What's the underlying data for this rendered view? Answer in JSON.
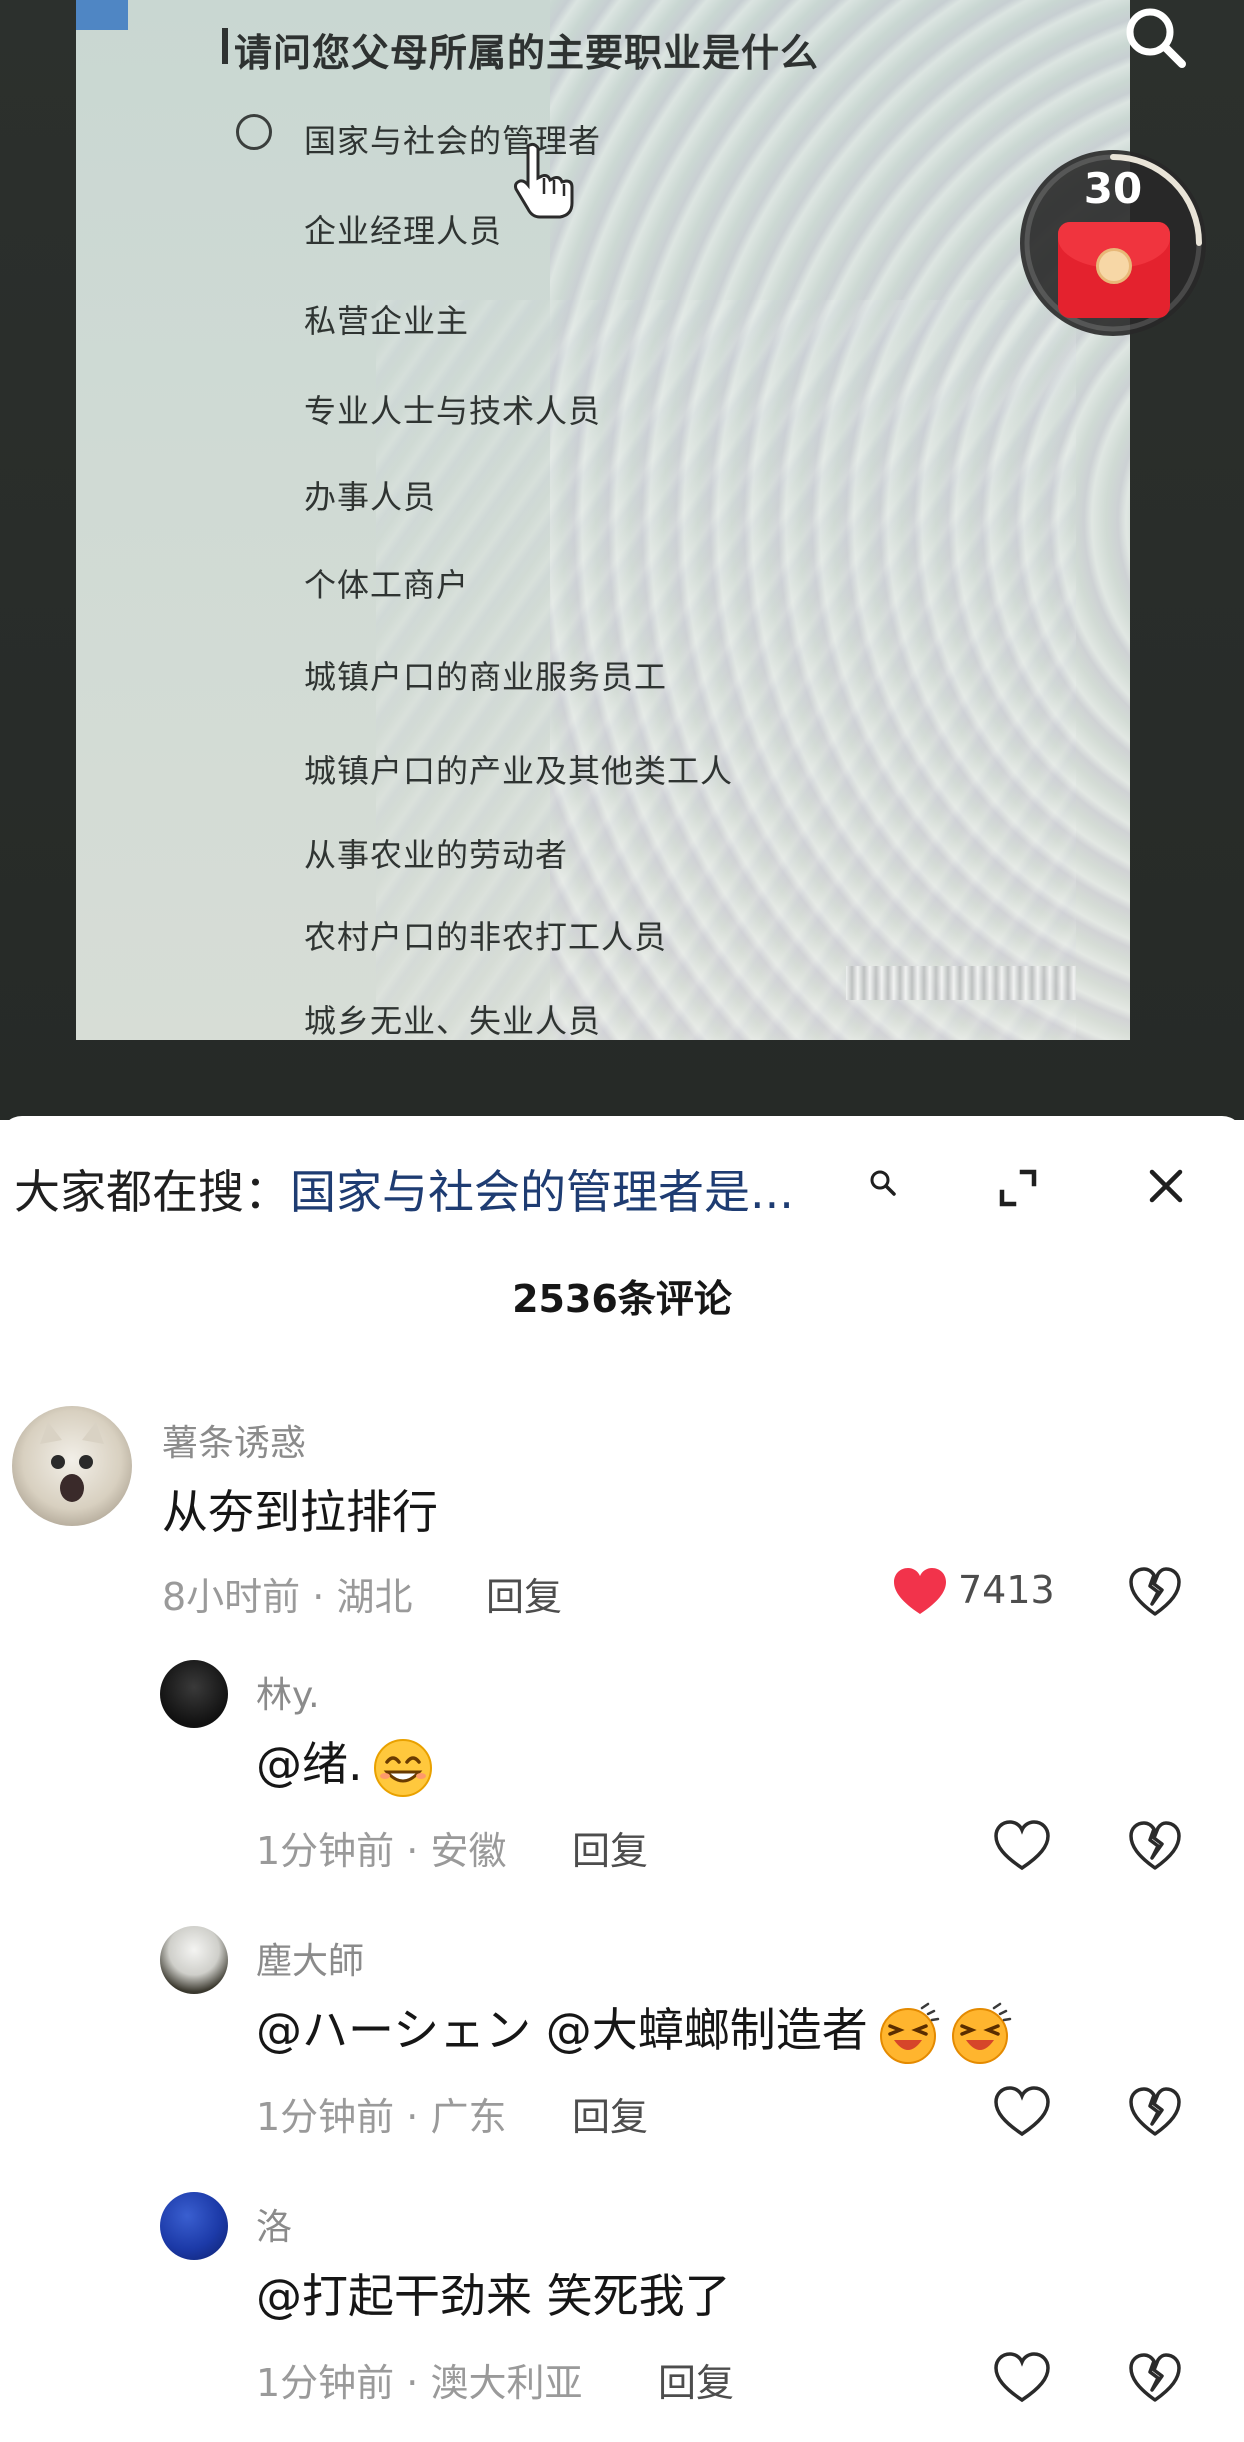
{
  "video": {
    "question": "请问您父母所属的主要职业是什么",
    "options": [
      "国家与社会的管理者",
      "企业经理人员",
      "私营企业主",
      "专业人士与技术人员",
      "办事人员",
      "个体工商户",
      "城镇户口的商业服务员工",
      "城镇户口的产业及其他类工人",
      "从事农业的劳动者",
      "农村户口的非农打工人员",
      "城乡无业、失业人员"
    ],
    "redpack_count": "30"
  },
  "sheet": {
    "search_hint_prefix": "大家都在搜：",
    "search_hint_query": "国家与社会的管理者是...",
    "comment_count": "2536条评论"
  },
  "comments": [
    {
      "name": "薯条诱惑",
      "text": "从夯到拉排行",
      "time": "8小时前",
      "location": "湖北",
      "reply": "回复",
      "likes": "7413",
      "liked": true
    },
    {
      "name": "林y.",
      "text": "@绪.",
      "time": "1分钟前",
      "location": "安徽",
      "reply": "回复",
      "emoji": "grin-emoji"
    },
    {
      "name": "塵大師",
      "text": "@ハーシェン @大蟑螂制造者",
      "time": "1分钟前",
      "location": "广东",
      "reply": "回复",
      "emoji": "laugh-emoji"
    },
    {
      "name": "洛",
      "text": "@打起干劲来 笑死我了",
      "time": "1分钟前",
      "location": "澳大利亚",
      "reply": "回复"
    }
  ],
  "colors": {
    "accent_red": "#f2334b",
    "text_primary": "#161616",
    "text_secondary": "#9a9a9a"
  }
}
